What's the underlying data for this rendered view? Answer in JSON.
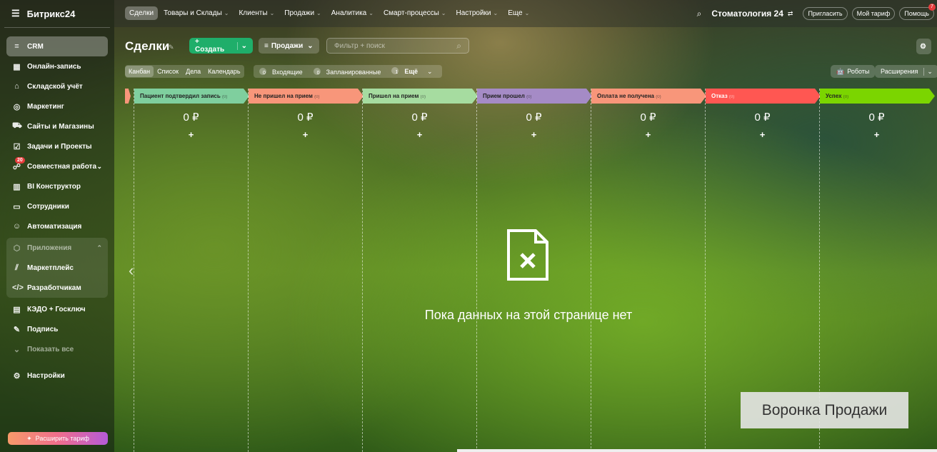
{
  "sidebar": {
    "logo": "Битрикс24",
    "items": [
      {
        "label": "CRM",
        "icon": "funnel-icon"
      },
      {
        "label": "Онлайн-запись",
        "icon": "calendar-icon"
      },
      {
        "label": "Складской учёт",
        "icon": "warehouse-icon"
      },
      {
        "label": "Маркетинг",
        "icon": "target-icon"
      },
      {
        "label": "Сайты и Магазины",
        "icon": "cart-icon"
      },
      {
        "label": "Задачи и Проекты",
        "icon": "checkbox-icon"
      },
      {
        "label": "Совместная работа",
        "icon": "chat-icon",
        "badge": "20"
      },
      {
        "label": "BI Конструктор",
        "icon": "chart-icon"
      },
      {
        "label": "Сотрудники",
        "icon": "id-card-icon"
      },
      {
        "label": "Автоматизация",
        "icon": "robot-icon"
      }
    ],
    "group": {
      "label": "Приложения",
      "items": [
        "Маркетплейс",
        "Разработчикам"
      ]
    },
    "items2": [
      "КЭДО + Госключ",
      "Подпись",
      "Показать все"
    ],
    "settings": "Настройки",
    "upgrade": "Расширить тариф"
  },
  "topbar": {
    "tabs": [
      "Сделки",
      "Товары и Склады",
      "Клиенты",
      "Продажи",
      "Аналитика",
      "Смарт-процессы",
      "Настройки",
      "Еще"
    ],
    "portal": "Стоматология 24",
    "invite": "Пригласить",
    "tariff": "Мой тариф",
    "help": "Помощь",
    "help_badge": "7"
  },
  "toolbar": {
    "title": "Сделки",
    "create": "+ Создать",
    "funnel": "Продажи",
    "filter_placeholder": "Фильтр + поиск",
    "views": [
      "Канбан",
      "Список",
      "Дела",
      "Календарь"
    ],
    "counters": [
      {
        "n": "0",
        "label": "Входящие"
      },
      {
        "n": "0",
        "label": "Запланированные"
      },
      {
        "n": "1",
        "label": "Ещё"
      }
    ],
    "robots": "Роботы",
    "extensions": "Расширения"
  },
  "columns": [
    {
      "title": "Пациент подтвердил запись",
      "count": "(0)",
      "amount": "0 ₽",
      "color": "#7fcf9e"
    },
    {
      "title": "Не пришел на прием",
      "count": "(0)",
      "amount": "0 ₽",
      "color": "#f8967a"
    },
    {
      "title": "Пришел на прием",
      "count": "(0)",
      "amount": "0 ₽",
      "color": "#a6dca0"
    },
    {
      "title": "Прием прошел",
      "count": "(0)",
      "amount": "0 ₽",
      "color": "#a58bc6"
    },
    {
      "title": "Оплата не получена",
      "count": "(0)",
      "amount": "0 ₽",
      "color": "#f8967a"
    },
    {
      "title": "Отказ",
      "count": "(0)",
      "amount": "0 ₽",
      "color": "#ff5752"
    },
    {
      "title": "Успех",
      "count": "(0)",
      "amount": "0 ₽",
      "color": "#7bd500"
    }
  ],
  "empty": "Пока данных на этой странице нет",
  "watermark": "Воронка Продажи"
}
